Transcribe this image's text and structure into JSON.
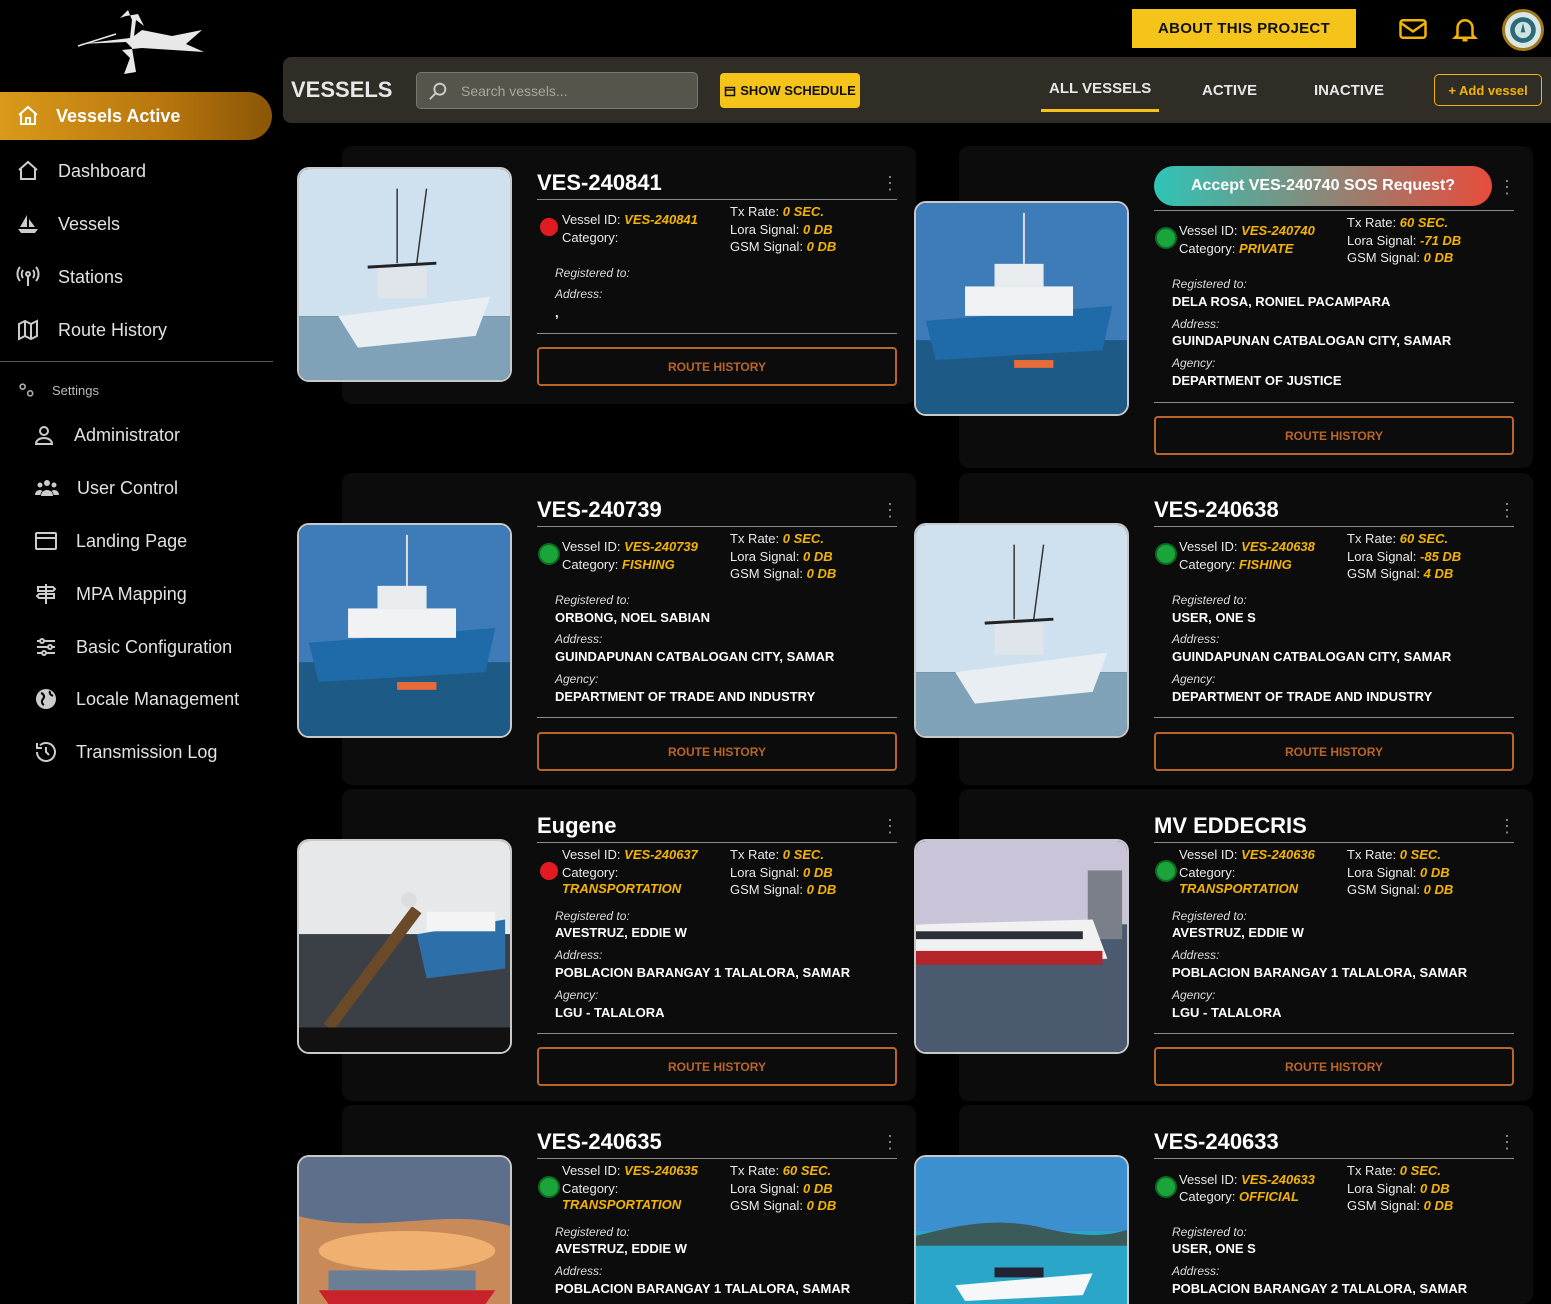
{
  "topbar": {
    "about_label": "ABOUT THIS PROJECT"
  },
  "sidebar": {
    "active_label": "Vessels Active",
    "items": [
      {
        "label": "Dashboard",
        "icon": "home-icon"
      },
      {
        "label": "Vessels",
        "icon": "ship-icon"
      },
      {
        "label": "Stations",
        "icon": "antenna-icon"
      },
      {
        "label": "Route History",
        "icon": "map-icon"
      }
    ],
    "settings_label": "Settings",
    "settings_items": [
      {
        "label": "Administrator",
        "icon": "user-icon"
      },
      {
        "label": "User Control",
        "icon": "users-icon"
      },
      {
        "label": "Landing Page",
        "icon": "window-icon"
      },
      {
        "label": "MPA Mapping",
        "icon": "signpost-icon"
      },
      {
        "label": "Basic Configuration",
        "icon": "sliders-icon"
      },
      {
        "label": "Locale Management",
        "icon": "globe-icon"
      },
      {
        "label": "Transmission Log",
        "icon": "history-icon"
      }
    ]
  },
  "header": {
    "title": "VESSELS",
    "search_placeholder": "Search vessels...",
    "schedule_label": "SHOW SCHEDULE",
    "tabs": [
      "ALL VESSELS",
      "ACTIVE",
      "INACTIVE"
    ],
    "add_label": "+ Add vessel"
  },
  "labels": {
    "vessel_id": "Vessel ID:",
    "category": "Category:",
    "tx_rate": "Tx Rate:",
    "lora": "Lora Signal:",
    "gsm": "GSM Signal:",
    "registered": "Registered to:",
    "address": "Address:",
    "agency": "Agency:",
    "route_history": "ROUTE HISTORY"
  },
  "sos": {
    "label": "Accept VES-240740 SOS Request?"
  },
  "vessels": [
    {
      "title": "VES-240841",
      "id": "VES-240841",
      "category": "",
      "tx": "0 SEC.",
      "lora": "0 DB",
      "gsm": "0 DB",
      "registered": "",
      "address": ",",
      "agency": "",
      "status": "red"
    },
    {
      "title": "",
      "id": "VES-240740",
      "category": "PRIVATE",
      "tx": "60 SEC.",
      "lora": "-71 DB",
      "gsm": "0 DB",
      "registered": "DELA ROSA, RONIEL PACAMPARA",
      "address": "GUINDAPUNAN CATBALOGAN CITY, SAMAR",
      "agency": "DEPARTMENT OF JUSTICE",
      "status": "green"
    },
    {
      "title": "VES-240739",
      "id": "VES-240739",
      "category": "FISHING",
      "tx": "0 SEC.",
      "lora": "0 DB",
      "gsm": "0 DB",
      "registered": "ORBONG, NOEL SABIAN",
      "address": "GUINDAPUNAN CATBALOGAN CITY, SAMAR",
      "agency": "DEPARTMENT OF TRADE AND INDUSTRY",
      "status": "green"
    },
    {
      "title": "VES-240638",
      "id": "VES-240638",
      "category": "FISHING",
      "tx": "60 SEC.",
      "lora": "-85 DB",
      "gsm": "4 DB",
      "registered": "USER, ONE S",
      "address": "GUINDAPUNAN CATBALOGAN CITY, SAMAR",
      "agency": "DEPARTMENT OF TRADE AND INDUSTRY",
      "status": "green"
    },
    {
      "title": "Eugene",
      "id": "VES-240637",
      "category": "TRANSPORTATION",
      "tx": "0 SEC.",
      "lora": "0 DB",
      "gsm": "0 DB",
      "registered": "AVESTRUZ, EDDIE W",
      "address": "POBLACION BARANGAY 1 TALALORA, SAMAR",
      "agency": "LGU - TALALORA",
      "status": "red"
    },
    {
      "title": "MV EDDECRIS",
      "id": "VES-240636",
      "category": "TRANSPORTATION",
      "tx": "0 SEC.",
      "lora": "0 DB",
      "gsm": "0 DB",
      "registered": "AVESTRUZ, EDDIE W",
      "address": "POBLACION BARANGAY 1 TALALORA, SAMAR",
      "agency": "LGU - TALALORA",
      "status": "green"
    },
    {
      "title": "VES-240635",
      "id": "VES-240635",
      "category": "TRANSPORTATION",
      "tx": "60 SEC.",
      "lora": "0 DB",
      "gsm": "0 DB",
      "registered": "AVESTRUZ, EDDIE W",
      "address": "POBLACION BARANGAY 1 TALALORA, SAMAR",
      "agency": "",
      "status": "green"
    },
    {
      "title": "VES-240633",
      "id": "VES-240633",
      "category": "OFFICIAL",
      "tx": "0 SEC.",
      "lora": "0 DB",
      "gsm": "0 DB",
      "registered": "USER, ONE S",
      "address": "POBLACION BARANGAY 2 TALALORA, SAMAR",
      "agency": "",
      "status": "green"
    },
    {
      "kebab": "⋮"
    }
  ],
  "colors": {
    "accent": "#f4c41a",
    "orange": "#b9652a",
    "green": "#1aa43a",
    "red": "#e21b23"
  }
}
